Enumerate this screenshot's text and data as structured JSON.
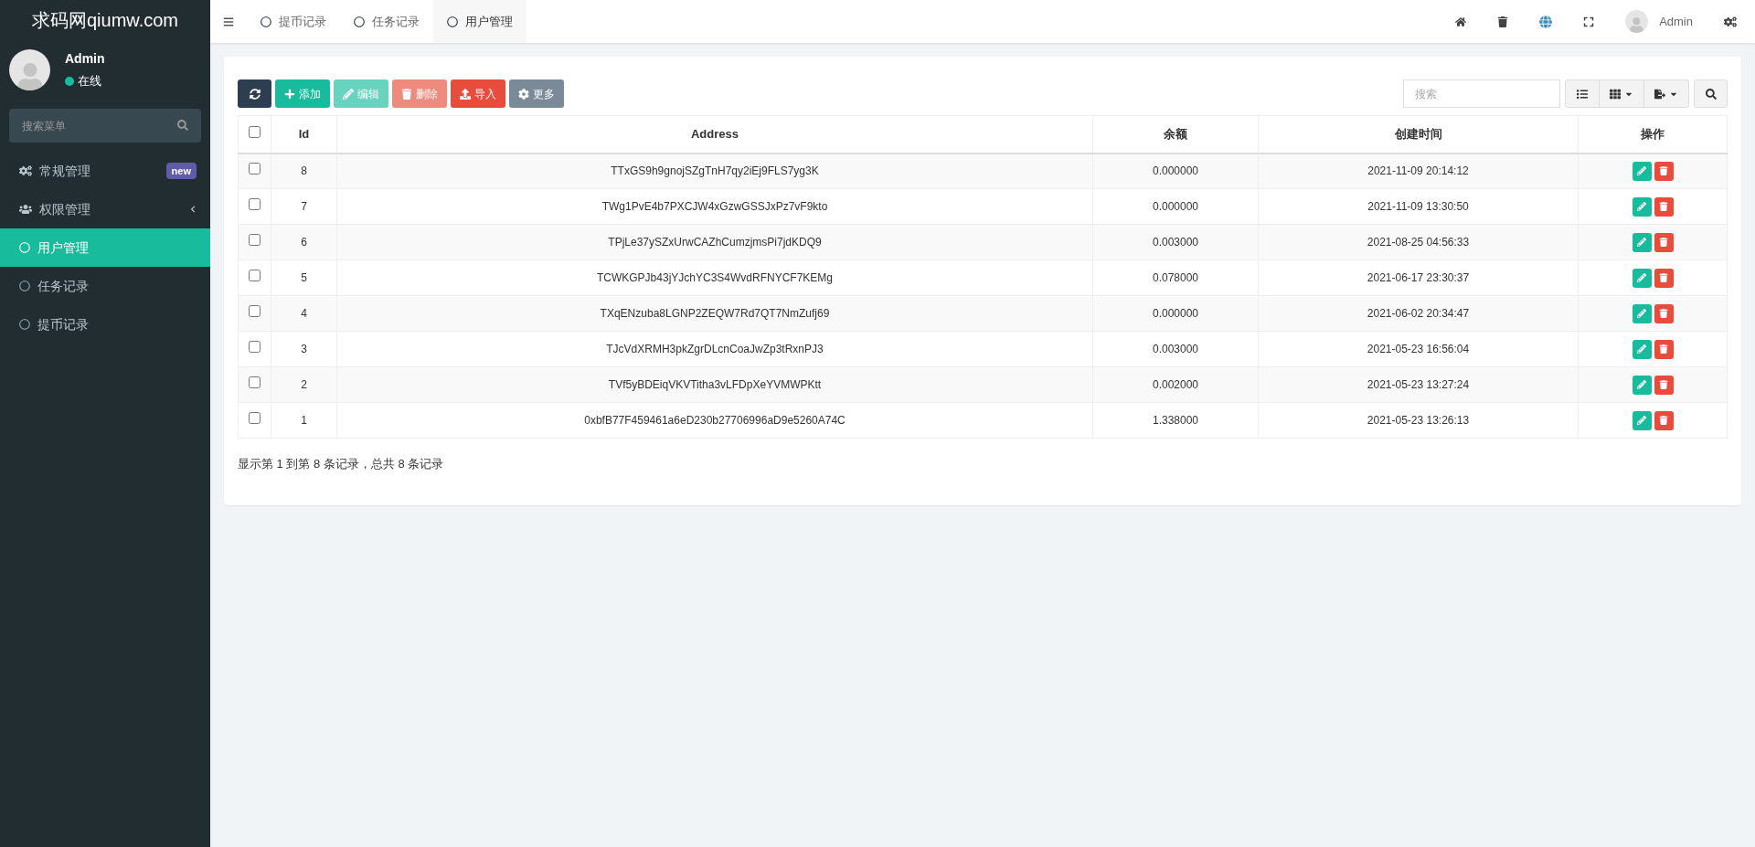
{
  "sidebar": {
    "logo": "求码网qiumw.com",
    "user": {
      "name": "Admin",
      "status": "在线",
      "online": true
    },
    "search": {
      "placeholder": "搜索菜单"
    },
    "items": [
      {
        "label": "常规管理",
        "kind": "general",
        "badge": "new",
        "selected": false
      },
      {
        "label": "权限管理",
        "kind": "permission",
        "expanded": false,
        "selected": false
      },
      {
        "label": "用户管理",
        "kind": "page",
        "selected": true
      },
      {
        "label": "任务记录",
        "kind": "page",
        "selected": false
      },
      {
        "label": "提币记录",
        "kind": "page",
        "selected": false
      }
    ]
  },
  "topbar": {
    "tabs": [
      {
        "label": "提币记录",
        "selected": false
      },
      {
        "label": "任务记录",
        "selected": false
      },
      {
        "label": "用户管理",
        "selected": true
      }
    ],
    "user": "Admin"
  },
  "toolbar": {
    "buttons": [
      {
        "kind": "refresh",
        "disabled": false
      },
      {
        "kind": "add",
        "label": "添加",
        "disabled": false
      },
      {
        "kind": "edit",
        "label": "编辑",
        "disabled": true
      },
      {
        "kind": "delete",
        "label": "删除",
        "disabled": true
      },
      {
        "kind": "import",
        "label": "导入",
        "disabled": false
      },
      {
        "kind": "more",
        "label": "更多",
        "disabled": false
      }
    ],
    "search": {
      "placeholder": "搜索"
    }
  },
  "table": {
    "columns": [
      "Id",
      "Address",
      "余额",
      "创建时间",
      "操作"
    ],
    "rows": [
      {
        "checked": false,
        "id": "8",
        "address": "TTxGS9h9gnojSZgTnH7qy2iEj9FLS7yg3K",
        "balance": "0.000000",
        "created": "2021-11-09 20:14:12"
      },
      {
        "checked": false,
        "id": "7",
        "address": "TWg1PvE4b7PXCJW4xGzwGSSJxPz7vF9kto",
        "balance": "0.000000",
        "created": "2021-11-09 13:30:50"
      },
      {
        "checked": false,
        "id": "6",
        "address": "TPjLe37ySZxUrwCAZhCumzjmsPi7jdKDQ9",
        "balance": "0.003000",
        "created": "2021-08-25 04:56:33"
      },
      {
        "checked": false,
        "id": "5",
        "address": "TCWKGPJb43jYJchYC3S4WvdRFNYCF7KEMg",
        "balance": "0.078000",
        "created": "2021-06-17 23:30:37"
      },
      {
        "checked": false,
        "id": "4",
        "address": "TXqENzuba8LGNP2ZEQW7Rd7QT7NmZufj69",
        "balance": "0.000000",
        "created": "2021-06-02 20:34:47"
      },
      {
        "checked": false,
        "id": "3",
        "address": "TJcVdXRMH3pkZgrDLcnCoaJwZp3tRxnPJ3",
        "balance": "0.003000",
        "created": "2021-05-23 16:56:04"
      },
      {
        "checked": false,
        "id": "2",
        "address": "TVf5yBDEiqVKVTitha3vLFDpXeYVMWPKtt",
        "balance": "0.002000",
        "created": "2021-05-23 13:27:24"
      },
      {
        "checked": false,
        "id": "1",
        "address": "0xbfB77F459461a6eD230b27706996aD9e5260A74C",
        "balance": "1.338000",
        "created": "2021-05-23 13:26:13"
      }
    ],
    "all_checked": false
  },
  "footer": "显示第 1 到第 8 条记录，总共 8 条记录"
}
